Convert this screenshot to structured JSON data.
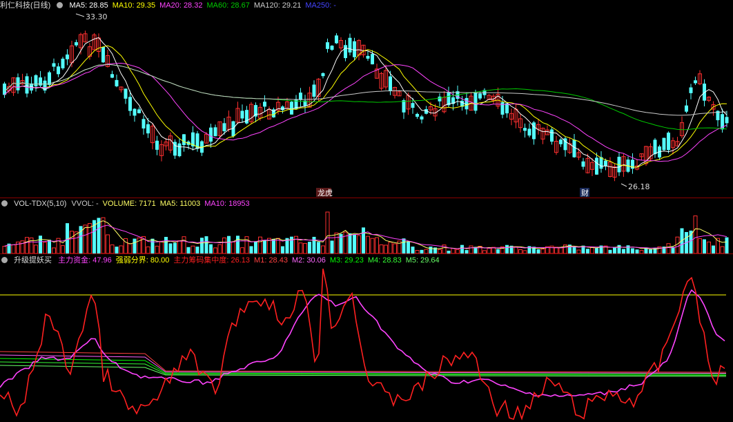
{
  "kline": {
    "title": "利仁科技(日线)",
    "ma": [
      {
        "label": "MA5: 28.85",
        "color": "#ffffff"
      },
      {
        "label": "MA10: 29.35",
        "color": "#ffff00"
      },
      {
        "label": "MA20: 28.32",
        "color": "#ff44ff"
      },
      {
        "label": "MA60: 28.67",
        "color": "#00cc00"
      },
      {
        "label": "MA120: 29.21",
        "color": "#cccccc"
      },
      {
        "label": "MA250: -",
        "color": "#4444ff"
      }
    ],
    "high_label": "33.30",
    "low_label": "26.18",
    "tag_lhb": "龙虎",
    "tag_cai": "财"
  },
  "volume": {
    "title": "VOL-TDX(5,10)",
    "items": [
      {
        "label": "VVOL: -",
        "color": "#cccccc"
      },
      {
        "label": "VOLUME: 7171",
        "color": "#ffff66"
      },
      {
        "label": "MA5: 11003",
        "color": "#ffff66"
      },
      {
        "label": "MA10: 18953",
        "color": "#ff44ff"
      }
    ]
  },
  "indicator": {
    "title": "升级提妖买",
    "items": [
      {
        "label": "主力资金: 47.96",
        "color": "#ff44ff"
      },
      {
        "label": "强弱分界: 80.00",
        "color": "#ffff00"
      },
      {
        "label": "主力筹码集中度: 26.13",
        "color": "#ff2020"
      },
      {
        "label": "M1: 28.43",
        "color": "#ff4040"
      },
      {
        "label": "M2: 30.06",
        "color": "#ff66ff"
      },
      {
        "label": "M3: 29.23",
        "color": "#00ff00"
      },
      {
        "label": "M4: 28.83",
        "color": "#33ff33"
      },
      {
        "label": "M5: 29.64",
        "color": "#66ff66"
      }
    ]
  }
}
